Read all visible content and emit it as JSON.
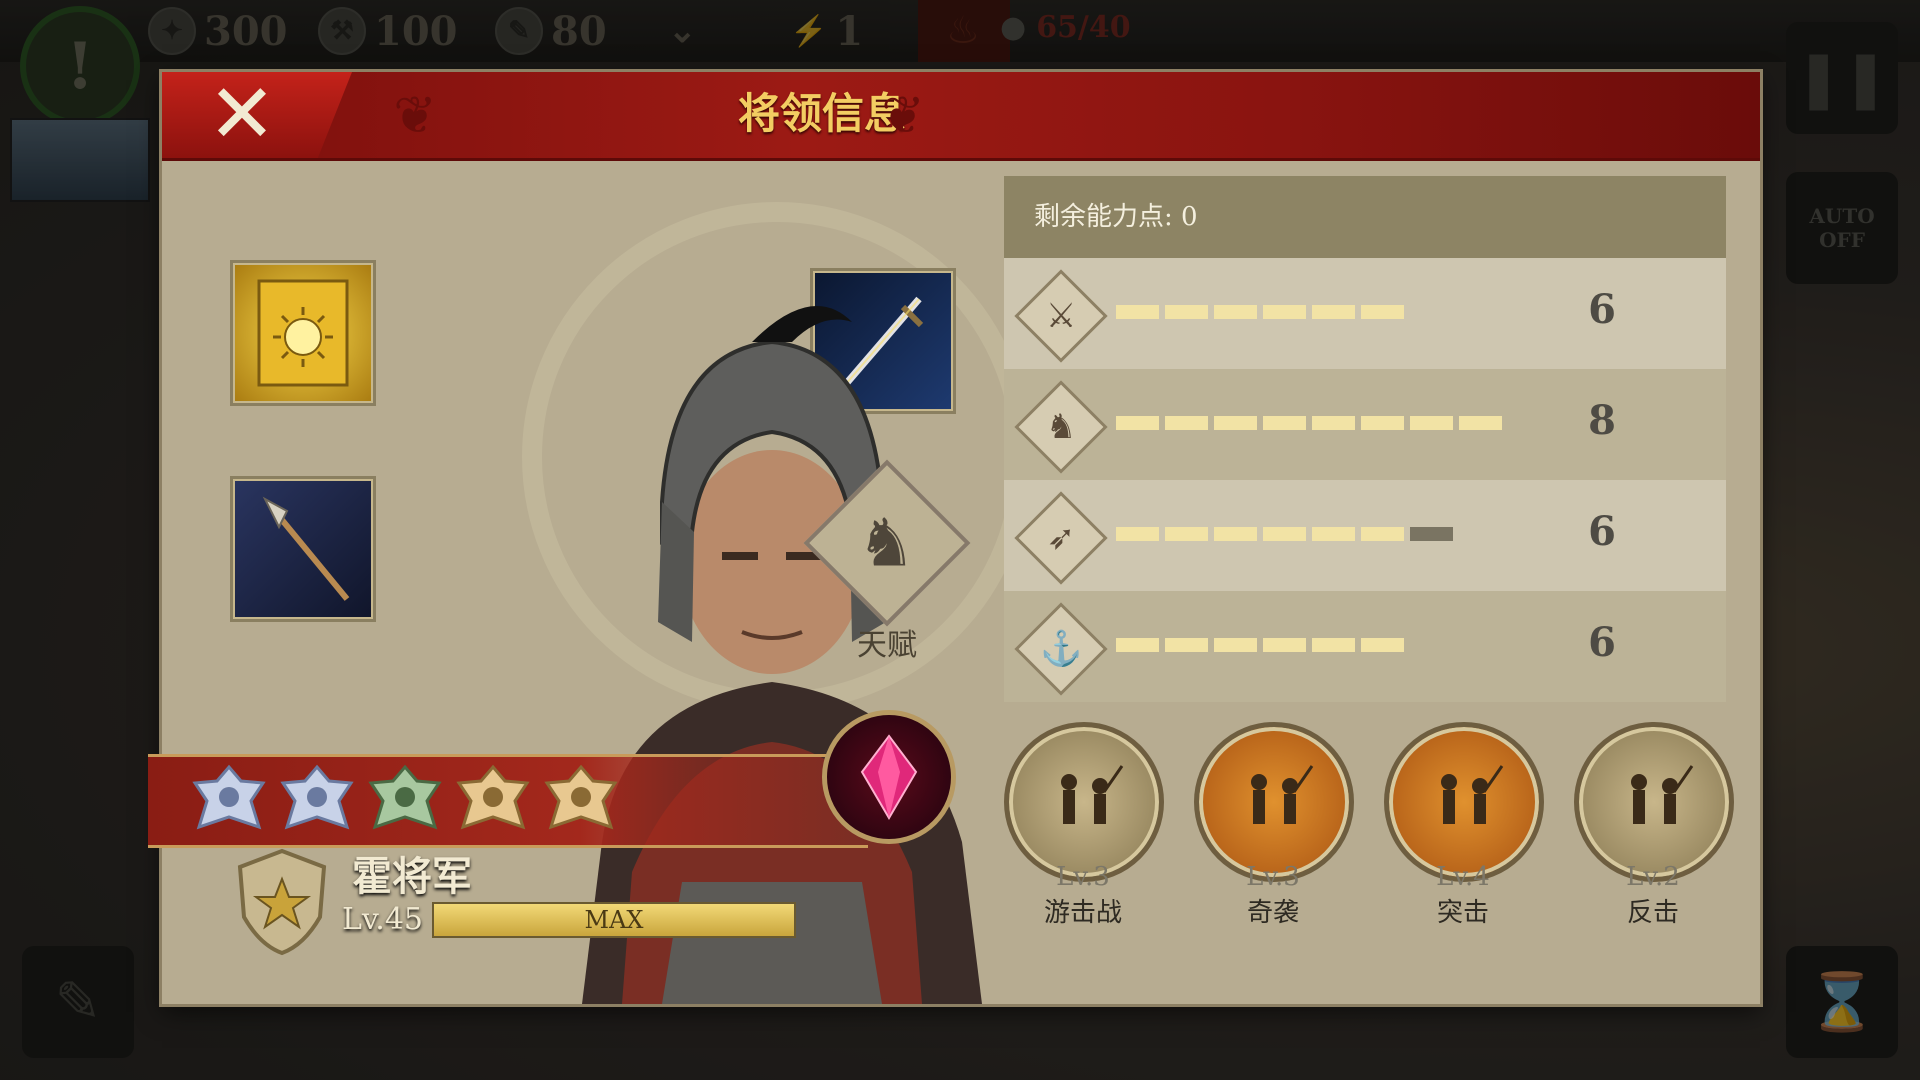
{
  "hud": {
    "resources": [
      {
        "icon": "eagle-coin-icon",
        "value": "300"
      },
      {
        "icon": "hammer-icon",
        "value": "100"
      },
      {
        "icon": "scroll-icon",
        "value": "80"
      }
    ],
    "expand_icon": "chevron-down-icon",
    "movement": {
      "icon": "boot-icon",
      "value": "1"
    },
    "fire_icon": "fire-icon",
    "population": {
      "icon": "person-icon",
      "value": "65/40"
    },
    "alert_icon": "exclamation-icon",
    "pause_icon": "pause-icon",
    "auto": {
      "line1": "AUTO",
      "line2": "OFF"
    }
  },
  "panel": {
    "title": "将领信息",
    "close_icon": "close-icon",
    "talent_label": "天赋",
    "ability_points_label": "剩余能力点: 0",
    "stats": [
      {
        "name": "sword-icon",
        "glyph": "⚔",
        "value": "6",
        "filled": 6,
        "max": 6
      },
      {
        "name": "horse-icon",
        "glyph": "♞",
        "value": "8",
        "filled": 8,
        "max": 8
      },
      {
        "name": "bow-icon",
        "glyph": "➶",
        "value": "6",
        "filled": 6,
        "max": 7
      },
      {
        "name": "anchor-icon",
        "glyph": "⚓",
        "value": "6",
        "filled": 6,
        "max": 6
      }
    ],
    "skills": [
      {
        "level": "Lv.3",
        "name": "游击战",
        "style": "plain"
      },
      {
        "level": "Lv.3",
        "name": "奇袭",
        "style": "gold"
      },
      {
        "level": "Lv.4",
        "name": "突击",
        "style": "gold"
      },
      {
        "level": "Lv.2",
        "name": "反击",
        "style": "plain"
      }
    ],
    "general": {
      "name": "霍将军",
      "level": "Lv.45",
      "exp_text": "MAX"
    },
    "badges": [
      "silver",
      "silver",
      "green",
      "gold",
      "gold"
    ],
    "colors": {
      "header_red": "#9c1a14",
      "title_gold": "#f3cd62",
      "panel_bg": "#b7ac91",
      "pip_fill": "#f2e3a5"
    }
  }
}
